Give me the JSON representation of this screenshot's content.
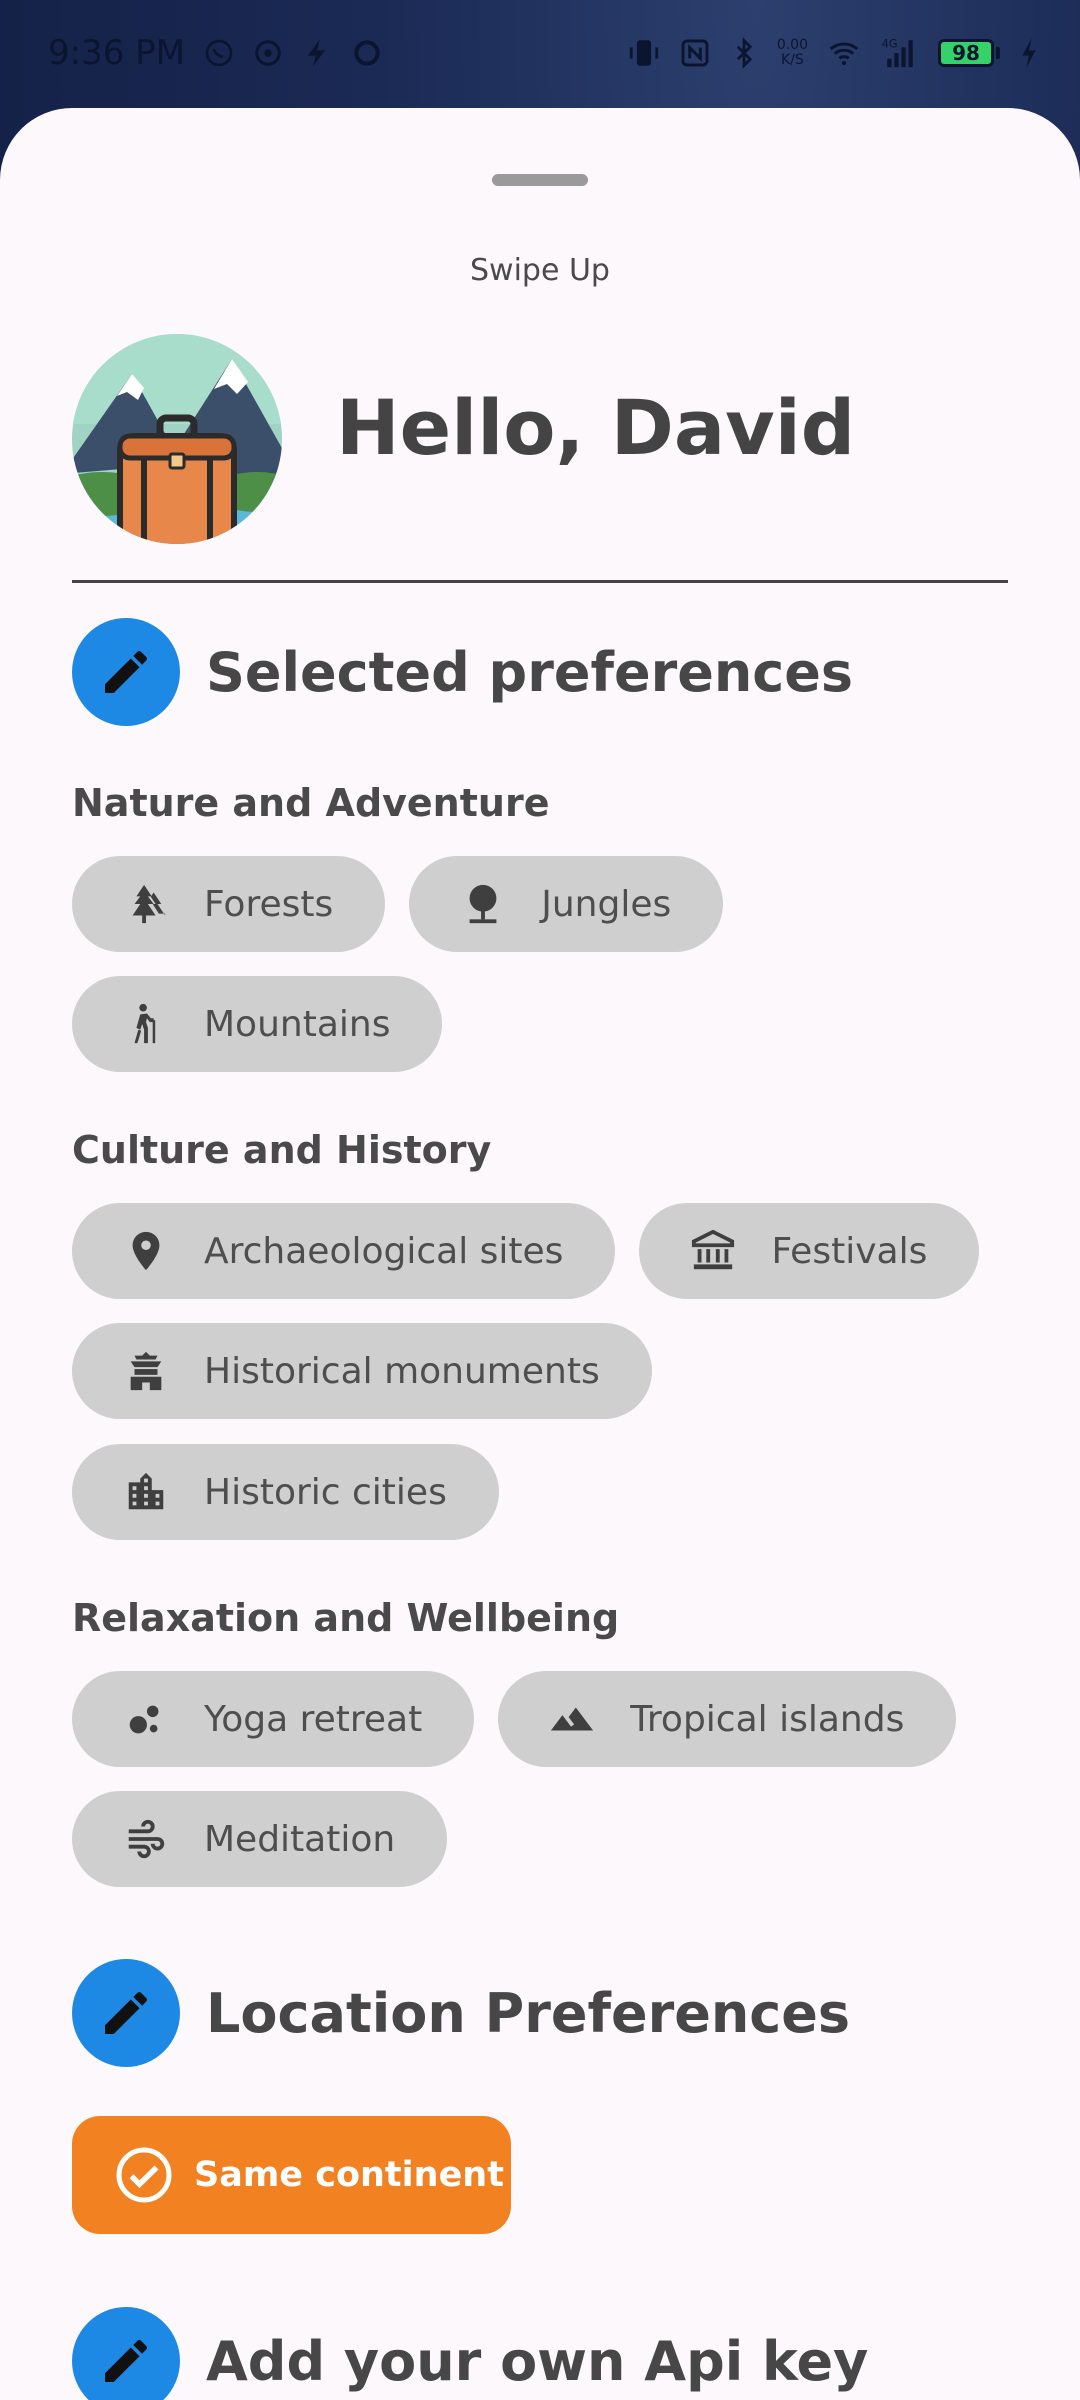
{
  "status_bar": {
    "time": "9:36 PM",
    "net_speed_value": "0.00",
    "net_speed_unit": "K/S",
    "network": "4G",
    "battery": "98"
  },
  "sheet": {
    "swipe_label": "Swipe Up",
    "greeting": "Hello, David"
  },
  "selected_preferences": {
    "title": "Selected preferences",
    "groups": [
      {
        "title": "Nature and Adventure",
        "chips": [
          {
            "label": "Forests",
            "icon": "forest-icon"
          },
          {
            "label": "Jungles",
            "icon": "tree-icon"
          },
          {
            "label": "Mountains",
            "icon": "hiking-icon"
          }
        ]
      },
      {
        "title": "Culture and History",
        "chips": [
          {
            "label": "Archaeological sites",
            "icon": "place-icon"
          },
          {
            "label": "Festivals",
            "icon": "museum-icon"
          },
          {
            "label": "Historical monuments",
            "icon": "temple-icon"
          },
          {
            "label": "Historic cities",
            "icon": "city-icon"
          }
        ]
      },
      {
        "title": "Relaxation and Wellbeing",
        "chips": [
          {
            "label": "Yoga retreat",
            "icon": "bubbles-icon"
          },
          {
            "label": "Tropical islands",
            "icon": "landscape-icon"
          },
          {
            "label": "Meditation",
            "icon": "air-icon"
          }
        ]
      }
    ]
  },
  "location_preferences": {
    "title": "Location Preferences",
    "selected": "Same continent"
  },
  "api_key": {
    "title": "Add your own Api key"
  },
  "colors": {
    "accent_blue": "#1e88e5",
    "accent_orange": "#f28122",
    "chip_bg": "#cfcfcf"
  }
}
